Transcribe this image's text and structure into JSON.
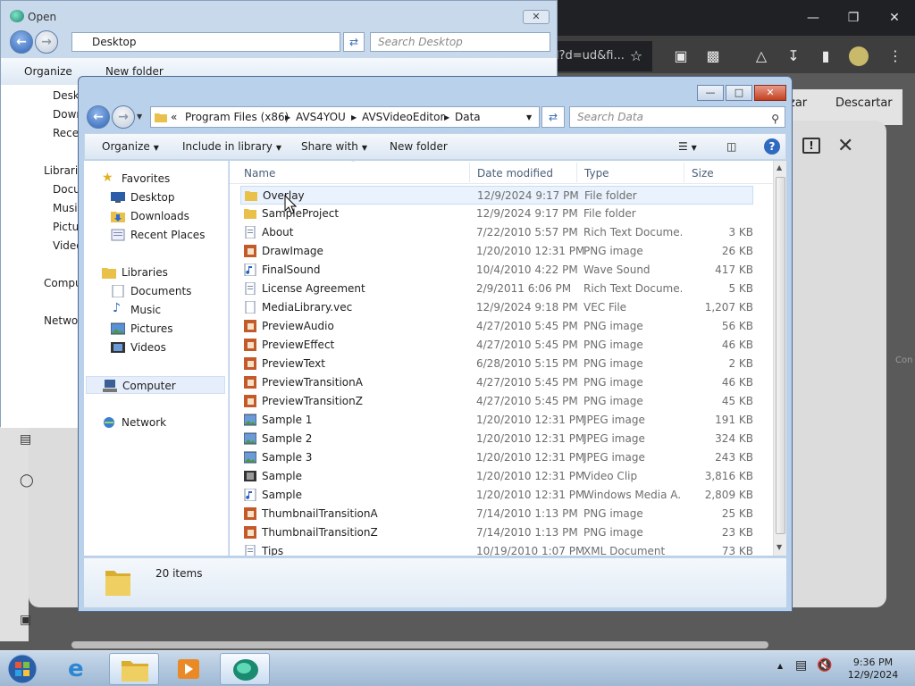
{
  "browser": {
    "omnibox_text": "l?d=ud&fi...",
    "right_buttons": [
      "zar",
      "Descartar"
    ]
  },
  "back_window": {
    "title": "Open",
    "address": "Desktop",
    "search_placeholder": "Search Desktop",
    "toolbar": {
      "organize": "Organize",
      "new_folder": "New folder"
    },
    "nav": [
      "Deskt",
      "Down",
      "Recen",
      "Librarie",
      "Docu",
      "Music",
      "Pictu",
      "Video",
      "Compu",
      "Networ"
    ]
  },
  "window": {
    "breadcrumb": [
      "Program Files (x86)",
      "AVS4YOU",
      "AVSVideoEditor",
      "Data"
    ],
    "breadcrumb_prefix": "«",
    "search_placeholder": "Search Data",
    "toolbar": {
      "organize": "Organize",
      "include_in_library": "Include in library",
      "share_with": "Share with",
      "new_folder": "New folder"
    },
    "nav": {
      "favorites": "Favorites",
      "desktop": "Desktop",
      "downloads": "Downloads",
      "recent_places": "Recent Places",
      "libraries": "Libraries",
      "documents": "Documents",
      "music": "Music",
      "pictures": "Pictures",
      "videos": "Videos",
      "computer": "Computer",
      "network": "Network"
    },
    "columns": {
      "name": "Name",
      "date": "Date modified",
      "type": "Type",
      "size": "Size"
    },
    "files": [
      {
        "name": "Overlay",
        "date": "12/9/2024 9:17 PM",
        "type": "File folder",
        "size": "",
        "icon": "folder-icon"
      },
      {
        "name": "SampleProject",
        "date": "12/9/2024 9:17 PM",
        "type": "File folder",
        "size": "",
        "icon": "folder-icon"
      },
      {
        "name": "About",
        "date": "7/22/2010 5:57 PM",
        "type": "Rich Text Docume...",
        "size": "3 KB",
        "icon": "document-icon"
      },
      {
        "name": "DrawImage",
        "date": "1/20/2010 12:31 PM",
        "type": "PNG image",
        "size": "26 KB",
        "icon": "image-icon"
      },
      {
        "name": "FinalSound",
        "date": "10/4/2010 4:22 PM",
        "type": "Wave Sound",
        "size": "417 KB",
        "icon": "audio-icon"
      },
      {
        "name": "License Agreement",
        "date": "2/9/2011 6:06 PM",
        "type": "Rich Text Docume...",
        "size": "5 KB",
        "icon": "document-icon"
      },
      {
        "name": "MediaLibrary.vec",
        "date": "12/9/2024 9:18 PM",
        "type": "VEC File",
        "size": "1,207 KB",
        "icon": "file-icon"
      },
      {
        "name": "PreviewAudio",
        "date": "4/27/2010 5:45 PM",
        "type": "PNG image",
        "size": "56 KB",
        "icon": "image-icon"
      },
      {
        "name": "PreviewEffect",
        "date": "4/27/2010 5:45 PM",
        "type": "PNG image",
        "size": "46 KB",
        "icon": "image-icon"
      },
      {
        "name": "PreviewText",
        "date": "6/28/2010 5:15 PM",
        "type": "PNG image",
        "size": "2 KB",
        "icon": "image-icon"
      },
      {
        "name": "PreviewTransitionA",
        "date": "4/27/2010 5:45 PM",
        "type": "PNG image",
        "size": "46 KB",
        "icon": "image-icon"
      },
      {
        "name": "PreviewTransitionZ",
        "date": "4/27/2010 5:45 PM",
        "type": "PNG image",
        "size": "45 KB",
        "icon": "image-icon"
      },
      {
        "name": "Sample 1",
        "date": "1/20/2010 12:31 PM",
        "type": "JPEG image",
        "size": "191 KB",
        "icon": "photo-icon"
      },
      {
        "name": "Sample 2",
        "date": "1/20/2010 12:31 PM",
        "type": "JPEG image",
        "size": "324 KB",
        "icon": "photo-icon"
      },
      {
        "name": "Sample 3",
        "date": "1/20/2010 12:31 PM",
        "type": "JPEG image",
        "size": "243 KB",
        "icon": "photo-icon"
      },
      {
        "name": "Sample",
        "date": "1/20/2010 12:31 PM",
        "type": "Video Clip",
        "size": "3,816 KB",
        "icon": "video-icon"
      },
      {
        "name": "Sample",
        "date": "1/20/2010 12:31 PM",
        "type": "Windows Media A...",
        "size": "2,809 KB",
        "icon": "audio-icon"
      },
      {
        "name": "ThumbnailTransitionA",
        "date": "7/14/2010 1:13 PM",
        "type": "PNG image",
        "size": "25 KB",
        "icon": "image-icon"
      },
      {
        "name": "ThumbnailTransitionZ",
        "date": "7/14/2010 1:13 PM",
        "type": "PNG image",
        "size": "23 KB",
        "icon": "image-icon"
      },
      {
        "name": "Tips",
        "date": "10/19/2010 1:07 PM",
        "type": "XML Document",
        "size": "73 KB",
        "icon": "document-icon"
      }
    ],
    "details": {
      "count": "20 items"
    }
  },
  "taskbar": {
    "time": "9:36 PM",
    "date": "12/9/2024"
  },
  "colors": {
    "selection": "#e9f2fd",
    "window_frame": "#b9d1ea",
    "accent": "#2f6ac0"
  }
}
